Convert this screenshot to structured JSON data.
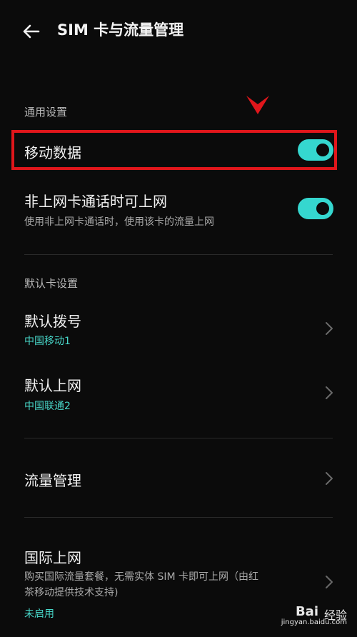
{
  "header": {
    "title": "SIM 卡与流量管理",
    "back_icon": "arrow-left-icon"
  },
  "general": {
    "section_label": "通用设置",
    "mobile_data": {
      "label": "移动数据",
      "enabled": true
    },
    "non_data_card": {
      "label": "非上网卡通话时可上网",
      "description": "使用非上网卡通话时，使用该卡的流量上网",
      "enabled": true
    }
  },
  "default_card": {
    "section_label": "默认卡设置",
    "dial": {
      "label": "默认拨号",
      "value": "中国移动1"
    },
    "data": {
      "label": "默认上网",
      "value": "中国联通2"
    }
  },
  "traffic": {
    "label": "流量管理"
  },
  "international": {
    "label": "国际上网",
    "description_line1": "购买国际流量套餐，无需实体 SIM 卡即可上网（由红",
    "description_line2": "茶移动提供技术支持)",
    "status": "未启用"
  },
  "colors": {
    "accent": "#35d7cf",
    "highlight": "#e0161b",
    "background": "#0b0b0b"
  },
  "watermark": {
    "logo": "Bai",
    "logo2": "经验",
    "url": "jingyan.baidu.com"
  }
}
